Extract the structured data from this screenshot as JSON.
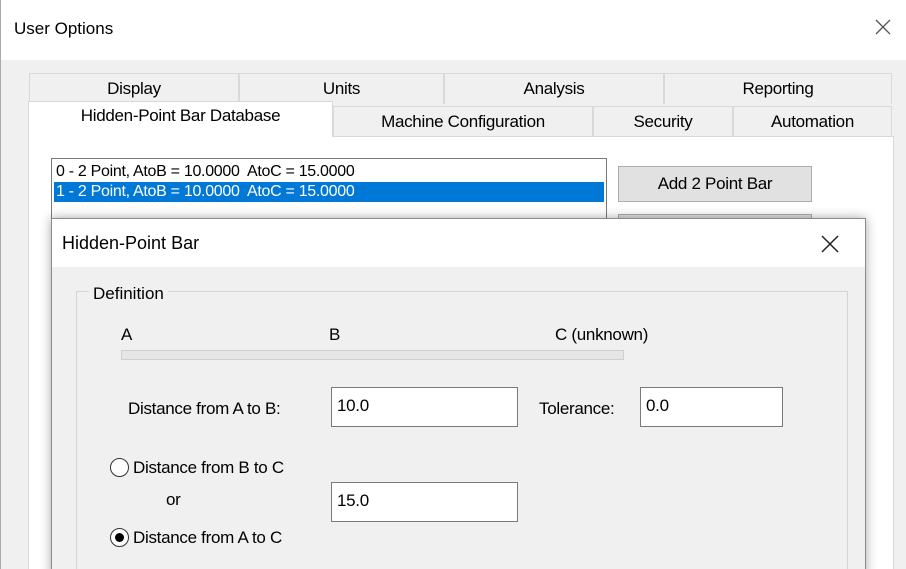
{
  "window": {
    "title": "User Options",
    "close_glyph": "×"
  },
  "tabs": {
    "back_row": [
      "Display",
      "Units",
      "Analysis",
      "Reporting"
    ],
    "front_row": [
      "Hidden-Point Bar Database",
      "Machine Configuration",
      "Security",
      "Automation"
    ],
    "active": "Hidden-Point Bar Database"
  },
  "bar_list": {
    "items": [
      "0 - 2 Point, AtoB = 10.0000  AtoC = 15.0000",
      "1 - 2 Point, AtoB = 10.0000  AtoC = 15.0000"
    ],
    "selected_index": 1
  },
  "buttons": {
    "add_2_point_bar": "Add 2 Point Bar"
  },
  "dialog": {
    "title": "Hidden-Point Bar",
    "group_label": "Definition",
    "point_a": "A",
    "point_b": "B",
    "point_c": "C (unknown)",
    "distance_ab_label": "Distance from A to B:",
    "distance_ab_value": "10.0",
    "tolerance_label": "Tolerance:",
    "tolerance_value": "0.0",
    "radio_bc_label": "Distance from B to C",
    "or_label": "or",
    "radio_ac_label": "Distance from A to C",
    "distance_c_value": "15.0",
    "selected_radio": "Distance from A to C"
  },
  "colors": {
    "selection": "#0078d7",
    "window_bg": "#f0f0f0"
  }
}
